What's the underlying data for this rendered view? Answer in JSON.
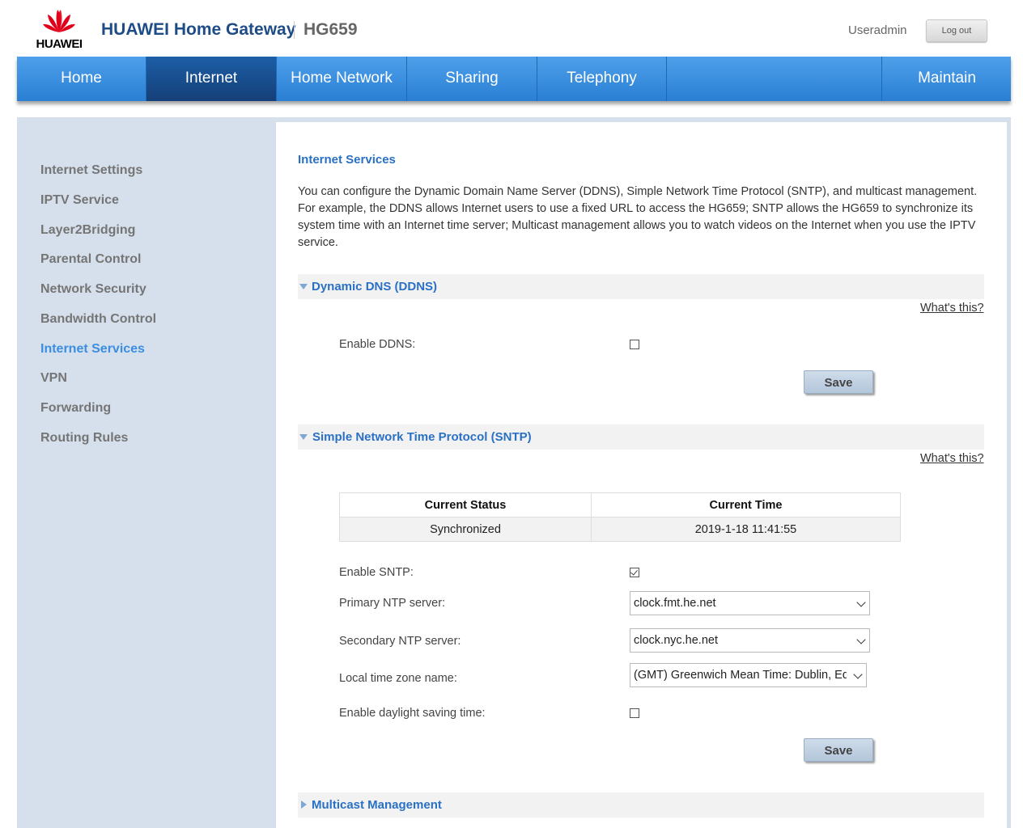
{
  "header": {
    "logo_text": "HUAWEI",
    "title": "HUAWEI Home Gateway",
    "model": "HG659",
    "user": "Useradmin",
    "logout_label": "Log out"
  },
  "nav": {
    "items": [
      {
        "label": "Home"
      },
      {
        "label": "Internet"
      },
      {
        "label": "Home Network"
      },
      {
        "label": "Sharing"
      },
      {
        "label": "Telephony"
      },
      {
        "label": "Maintain"
      }
    ],
    "active": "Internet"
  },
  "sidebar": {
    "items": [
      {
        "label": "Internet Settings"
      },
      {
        "label": "IPTV Service"
      },
      {
        "label": "Layer2Bridging"
      },
      {
        "label": "Parental Control"
      },
      {
        "label": "Network Security"
      },
      {
        "label": "Bandwidth Control"
      },
      {
        "label": "Internet Services"
      },
      {
        "label": "VPN"
      },
      {
        "label": "Forwarding"
      },
      {
        "label": "Routing Rules"
      }
    ],
    "active": "Internet Services"
  },
  "page": {
    "title": "Internet Services",
    "intro": "You can configure the Dynamic Domain Name Server (DDNS), Simple Network Time Protocol (SNTP), and multicast management. For example, the DDNS allows Internet users to use a fixed URL to access the HG659; SNTP allows the HG659 to synchronize its system time with an Internet time server; Multicast management allows you to watch videos on the Internet when you use the IPTV service."
  },
  "ddns": {
    "title": "Dynamic DNS (DDNS)",
    "whats_this": "What's this?",
    "enable_label": "Enable DDNS:",
    "enabled": false,
    "save_label": "Save"
  },
  "sntp": {
    "title": "Simple Network Time Protocol (SNTP)",
    "whats_this": "What's this?",
    "table": {
      "headers": [
        "Current Status",
        "Current Time"
      ],
      "row": [
        "Synchronized",
        "2019-1-18 11:41:55"
      ]
    },
    "enable_label": "Enable SNTP:",
    "enabled": true,
    "primary_label": "Primary NTP server:",
    "primary_value": "clock.fmt.he.net",
    "secondary_label": "Secondary NTP server:",
    "secondary_value": "clock.nyc.he.net",
    "timezone_label": "Local time zone name:",
    "timezone_value": "(GMT) Greenwich Mean Time: Dublin, Edinburgh, Lisbon, London",
    "dst_label": "Enable daylight saving time:",
    "dst_enabled": false,
    "save_label": "Save"
  },
  "multicast": {
    "title": "Multicast Management"
  },
  "colors": {
    "nav_blue": "#3b8ee0",
    "nav_active": "#1a4f8f",
    "link_blue": "#2a70c4",
    "brand_red": "#e1001a"
  }
}
